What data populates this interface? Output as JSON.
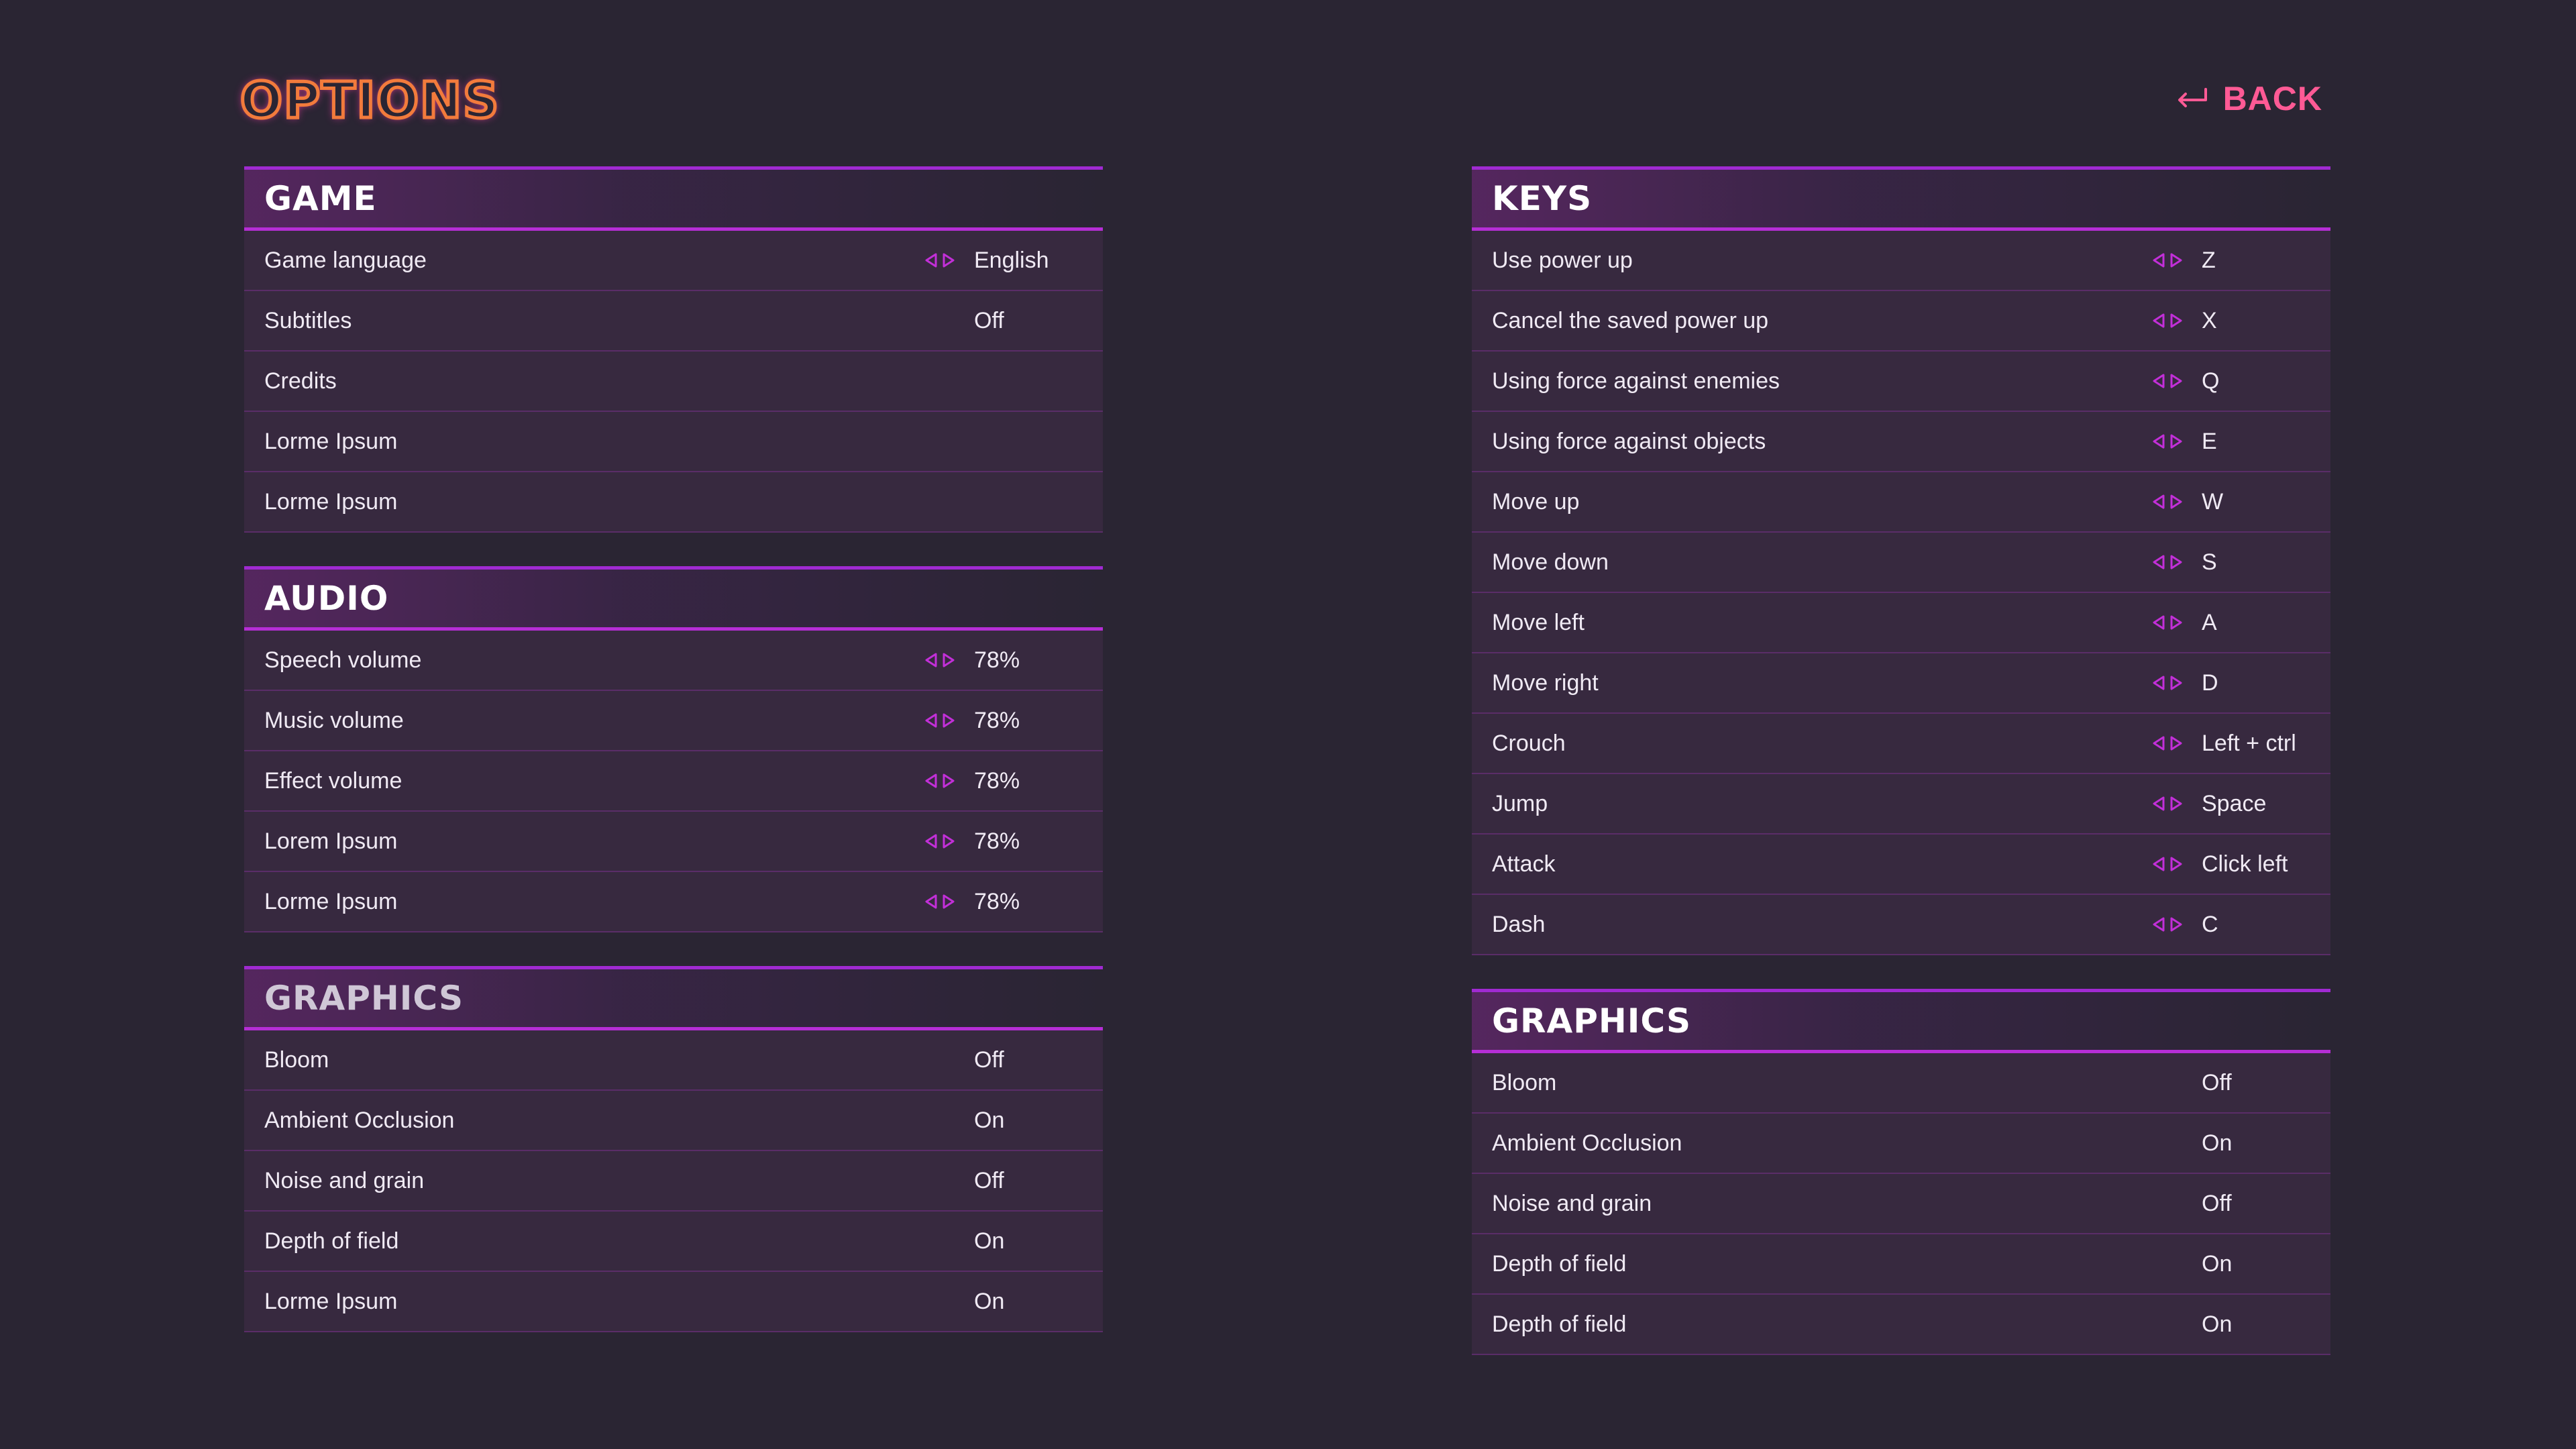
{
  "header": {
    "title": "OPTIONS",
    "back_label": "BACK"
  },
  "colors": {
    "background": "#2a2533",
    "accent": "#b62ed6",
    "back": "#ff5a95",
    "title_stroke": "#f27b3c"
  },
  "left": {
    "game": {
      "title": "GAME",
      "rows": [
        {
          "label": "Game language",
          "value": "English",
          "arrows": true
        },
        {
          "label": "Subtitles",
          "value": "Off",
          "arrows": false
        },
        {
          "label": "Credits",
          "value": "",
          "arrows": false
        },
        {
          "label": "Lorme Ipsum",
          "value": "",
          "arrows": false
        },
        {
          "label": "Lorme Ipsum",
          "value": "",
          "arrows": false
        }
      ]
    },
    "audio": {
      "title": "AUDIO",
      "rows": [
        {
          "label": "Speech volume",
          "value": "78%",
          "arrows": true
        },
        {
          "label": "Music volume",
          "value": "78%",
          "arrows": true
        },
        {
          "label": "Effect volume",
          "value": "78%",
          "arrows": true
        },
        {
          "label": "Lorem Ipsum",
          "value": "78%",
          "arrows": true
        },
        {
          "label": "Lorme Ipsum",
          "value": "78%",
          "arrows": true
        }
      ]
    },
    "graphics": {
      "title": "GRAPHICS",
      "rows": [
        {
          "label": "Bloom",
          "value": "Off",
          "arrows": false
        },
        {
          "label": "Ambient Occlusion",
          "value": "On",
          "arrows": false
        },
        {
          "label": "Noise and grain",
          "value": "Off",
          "arrows": false
        },
        {
          "label": "Depth of field",
          "value": "On",
          "arrows": false
        },
        {
          "label": "Lorme Ipsum",
          "value": "On",
          "arrows": false
        }
      ]
    }
  },
  "right": {
    "keys": {
      "title": "KEYS",
      "rows": [
        {
          "label": "Use power up",
          "value": "Z",
          "arrows": true
        },
        {
          "label": "Cancel the saved power up",
          "value": "X",
          "arrows": true
        },
        {
          "label": "Using force against enemies",
          "value": "Q",
          "arrows": true
        },
        {
          "label": "Using force against objects",
          "value": "E",
          "arrows": true
        },
        {
          "label": "Move up",
          "value": "W",
          "arrows": true
        },
        {
          "label": "Move down",
          "value": "S",
          "arrows": true
        },
        {
          "label": "Move left",
          "value": "A",
          "arrows": true
        },
        {
          "label": "Move right",
          "value": "D",
          "arrows": true
        },
        {
          "label": "Crouch",
          "value": "Left + ctrl",
          "arrows": true
        },
        {
          "label": "Jump",
          "value": "Space",
          "arrows": true
        },
        {
          "label": "Attack",
          "value": "Click left",
          "arrows": true
        },
        {
          "label": "Dash",
          "value": "C",
          "arrows": true
        }
      ]
    },
    "graphics": {
      "title": "GRAPHICS",
      "rows": [
        {
          "label": "Bloom",
          "value": "Off",
          "arrows": false
        },
        {
          "label": "Ambient Occlusion",
          "value": "On",
          "arrows": false
        },
        {
          "label": "Noise and grain",
          "value": "Off",
          "arrows": false
        },
        {
          "label": "Depth of field",
          "value": "On",
          "arrows": false
        },
        {
          "label": "Depth of field",
          "value": "On",
          "arrows": false
        }
      ]
    }
  }
}
